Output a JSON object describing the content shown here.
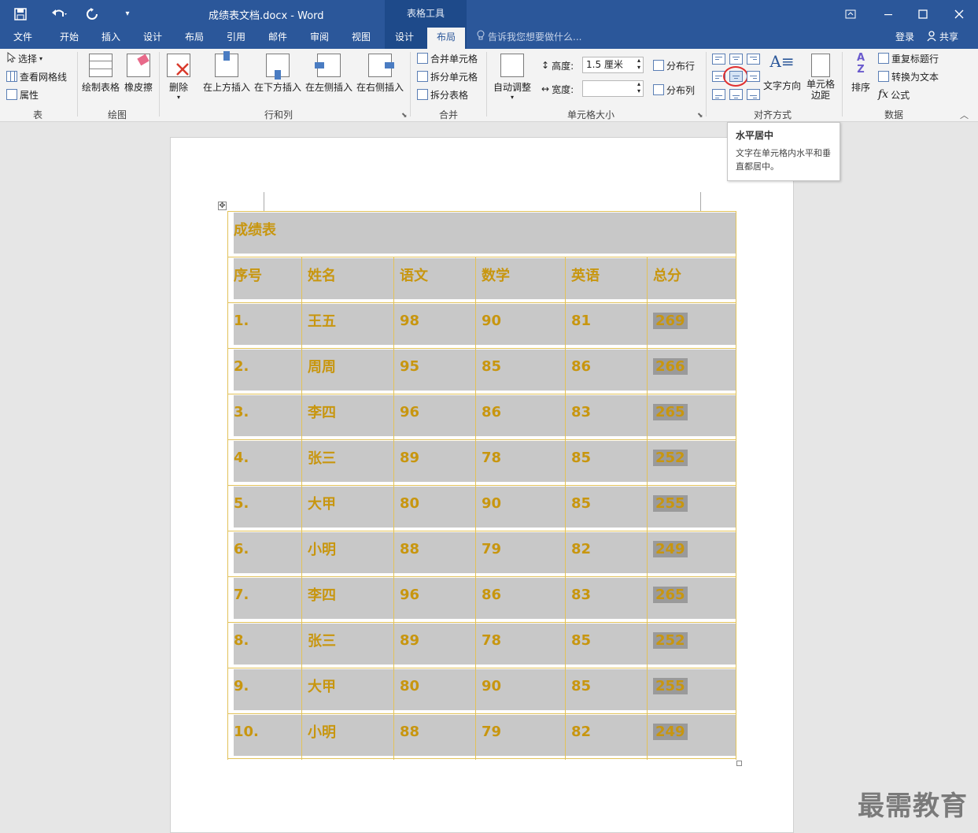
{
  "window": {
    "doc_title": "成绩表文档.docx - Word",
    "tools_title": "表格工具"
  },
  "tabs": [
    "文件",
    "开始",
    "插入",
    "设计",
    "布局",
    "引用",
    "邮件",
    "审阅",
    "视图",
    "设计",
    "布局"
  ],
  "tell_me": "告诉我您想要做什么...",
  "login": "登录",
  "share": "共享",
  "ribbon": {
    "table_group": {
      "label": "表",
      "select": "选择",
      "gridlines": "查看网格线",
      "properties": "属性"
    },
    "draw_group": {
      "label": "绘图",
      "draw_table": "绘制表格",
      "eraser": "橡皮擦"
    },
    "rows_cols_group": {
      "label": "行和列",
      "delete": "删除",
      "insert_above": "在上方插入",
      "insert_below": "在下方插入",
      "insert_left": "在左侧插入",
      "insert_right": "在右侧插入"
    },
    "merge_group": {
      "label": "合并",
      "merge_cells": "合并单元格",
      "split_cells": "拆分单元格",
      "split_table": "拆分表格"
    },
    "cell_size_group": {
      "label": "单元格大小",
      "autofit": "自动调整",
      "height_label": "高度:",
      "height_value": "1.5 厘米",
      "width_label": "宽度:",
      "width_value": "",
      "distribute_rows": "分布行",
      "distribute_cols": "分布列"
    },
    "align_group": {
      "label": "对齐方式",
      "text_direction": "文字方向",
      "cell_margins_1": "单元格",
      "cell_margins_2": "边距"
    },
    "data_group": {
      "label": "数据",
      "sort": "排序",
      "repeat_header": "重复标题行",
      "convert_text": "转换为文本",
      "formula": "公式"
    }
  },
  "tooltip": {
    "title": "水平居中",
    "desc": "文字在单元格内水平和垂直都居中。"
  },
  "table": {
    "title": "成绩表",
    "headers": [
      "序号",
      "姓名",
      "语文",
      "数学",
      "英语",
      "总分"
    ],
    "rows": [
      [
        "1.",
        "王五",
        "98",
        "90",
        "81",
        "269"
      ],
      [
        "2.",
        "周周",
        "95",
        "85",
        "86",
        "266"
      ],
      [
        "3.",
        "李四",
        "96",
        "86",
        "83",
        "265"
      ],
      [
        "4.",
        "张三",
        "89",
        "78",
        "85",
        "252"
      ],
      [
        "5.",
        "大甲",
        "80",
        "90",
        "85",
        "255"
      ],
      [
        "6.",
        "小明",
        "88",
        "79",
        "82",
        "249"
      ],
      [
        "7.",
        "李四",
        "96",
        "86",
        "83",
        "265"
      ],
      [
        "8.",
        "张三",
        "89",
        "78",
        "85",
        "252"
      ],
      [
        "9.",
        "大甲",
        "80",
        "90",
        "85",
        "255"
      ],
      [
        "10.",
        "小明",
        "88",
        "79",
        "82",
        "249"
      ]
    ]
  },
  "watermark": "最需教育"
}
